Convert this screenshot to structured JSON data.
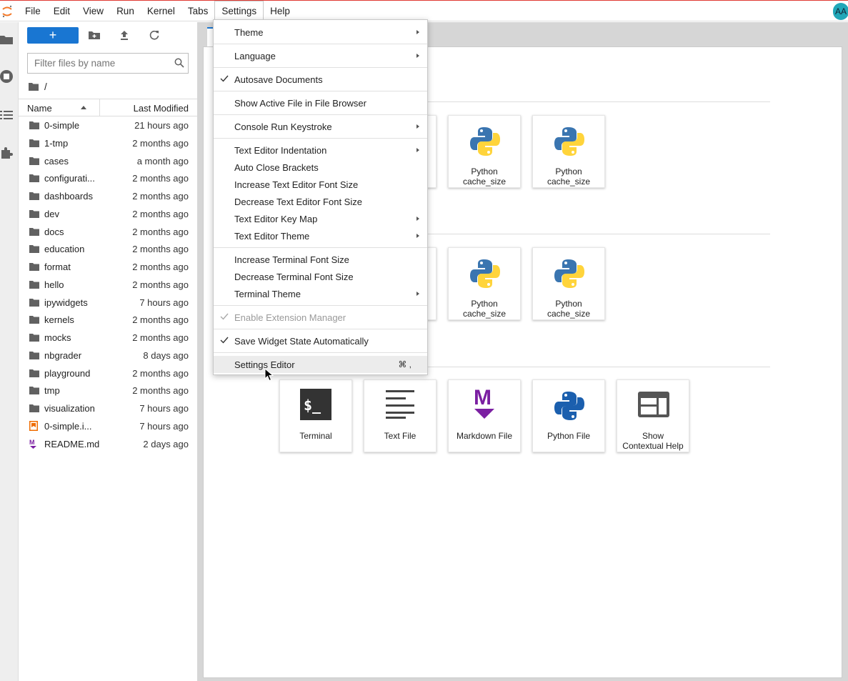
{
  "menubar": {
    "items": [
      "File",
      "Edit",
      "View",
      "Run",
      "Kernel",
      "Tabs",
      "Settings",
      "Help"
    ],
    "active": "Settings",
    "user_initials": "AA"
  },
  "file_browser": {
    "new_button": "+",
    "search_placeholder": "Filter files by name",
    "breadcrumb": "/",
    "columns": {
      "name": "Name",
      "modified": "Last Modified"
    },
    "files": [
      {
        "name": "0-simple",
        "modified": "21 hours ago",
        "type": "folder"
      },
      {
        "name": "1-tmp",
        "modified": "2 months ago",
        "type": "folder"
      },
      {
        "name": "cases",
        "modified": "a month ago",
        "type": "folder"
      },
      {
        "name": "configurati...",
        "modified": "2 months ago",
        "type": "folder"
      },
      {
        "name": "dashboards",
        "modified": "2 months ago",
        "type": "folder"
      },
      {
        "name": "dev",
        "modified": "2 months ago",
        "type": "folder"
      },
      {
        "name": "docs",
        "modified": "2 months ago",
        "type": "folder"
      },
      {
        "name": "education",
        "modified": "2 months ago",
        "type": "folder"
      },
      {
        "name": "format",
        "modified": "2 months ago",
        "type": "folder"
      },
      {
        "name": "hello",
        "modified": "2 months ago",
        "type": "folder"
      },
      {
        "name": "ipywidgets",
        "modified": "7 hours ago",
        "type": "folder"
      },
      {
        "name": "kernels",
        "modified": "2 months ago",
        "type": "folder"
      },
      {
        "name": "mocks",
        "modified": "2 months ago",
        "type": "folder"
      },
      {
        "name": "nbgrader",
        "modified": "8 days ago",
        "type": "folder"
      },
      {
        "name": "playground",
        "modified": "2 months ago",
        "type": "folder"
      },
      {
        "name": "tmp",
        "modified": "2 months ago",
        "type": "folder"
      },
      {
        "name": "visualization",
        "modified": "7 hours ago",
        "type": "folder"
      },
      {
        "name": "0-simple.i...",
        "modified": "7 hours ago",
        "type": "notebook"
      },
      {
        "name": "README.md",
        "modified": "2 days ago",
        "type": "markdown"
      }
    ]
  },
  "settings_menu": {
    "items": [
      {
        "label": "Theme",
        "submenu": true
      },
      {
        "label": "Language",
        "submenu": true
      },
      {
        "label": "Autosave Documents",
        "checked": true
      },
      {
        "label": "Show Active File in File Browser"
      },
      {
        "label": "Console Run Keystroke",
        "submenu": true
      },
      {
        "label": "Text Editor Indentation",
        "submenu": true
      },
      {
        "label": "Auto Close Brackets"
      },
      {
        "label": "Increase Text Editor Font Size"
      },
      {
        "label": "Decrease Text Editor Font Size"
      },
      {
        "label": "Text Editor Key Map",
        "submenu": true
      },
      {
        "label": "Text Editor Theme",
        "submenu": true
      },
      {
        "label": "Increase Terminal Font Size"
      },
      {
        "label": "Decrease Terminal Font Size"
      },
      {
        "label": "Terminal Theme",
        "submenu": true
      },
      {
        "label": "Enable Extension Manager",
        "checked": true,
        "disabled": true
      },
      {
        "label": "Save Widget State Automatically",
        "checked": true
      },
      {
        "label": "Settings Editor",
        "shortcut": "⌘ ,",
        "hovered": true
      }
    ]
  },
  "launcher": {
    "notebook_cards": [
      {
        "line1": "Python",
        "line2": "cache_size"
      },
      {
        "line1": "Python",
        "line2": "cache_size"
      }
    ],
    "console_cards": [
      {
        "line1": "Python",
        "line2": "cache_size"
      },
      {
        "line1": "Python",
        "line2": "cache_size"
      }
    ],
    "other_cards": [
      {
        "line1": "Terminal",
        "line2": "",
        "icon": "terminal-icon"
      },
      {
        "line1": "Text File",
        "line2": "",
        "icon": "text-file-icon"
      },
      {
        "line1": "Markdown File",
        "line2": "",
        "icon": "markdown-icon"
      },
      {
        "line1": "Python File",
        "line2": "",
        "icon": "python-file-icon"
      },
      {
        "line1": "Show",
        "line2": "Contextual Help",
        "icon": "contextual-help-icon"
      }
    ]
  },
  "colors": {
    "accent": "#1976d2",
    "topbar_border": "#e03a32",
    "markdown": "#7b1fa2",
    "python_blue": "#3a75b0",
    "python_yellow": "#ffd43b"
  }
}
